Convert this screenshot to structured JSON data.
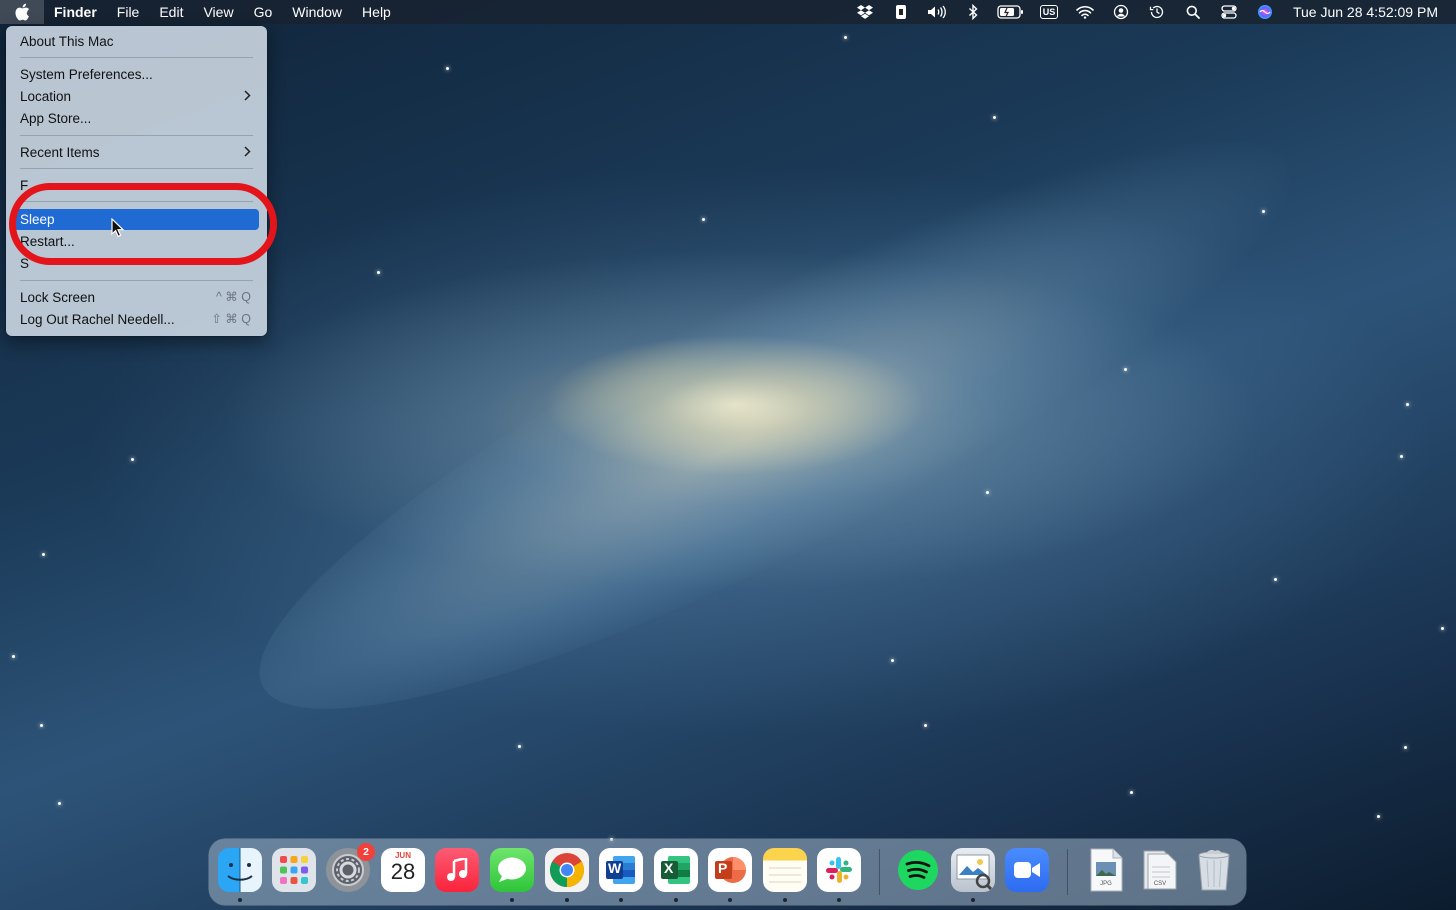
{
  "menubar": {
    "app_name": "Finder",
    "menus": [
      "File",
      "Edit",
      "View",
      "Go",
      "Window",
      "Help"
    ],
    "keyboard_layout": "US",
    "clock": "Tue Jun 28  4:52:09 PM"
  },
  "apple_menu": {
    "items": {
      "about": "About This Mac",
      "system_prefs": "System Preferences...",
      "location": "Location",
      "app_store": "App Store...",
      "recent_items": "Recent Items",
      "force_quit_partial": "F",
      "sleep": "Sleep",
      "restart": "Restart...",
      "shutdown_partial": "S",
      "lock_screen": "Lock Screen",
      "lock_screen_shortcut": "^ ⌘ Q",
      "log_out": "Log Out Rachel Needell...",
      "log_out_shortcut": "⇧ ⌘ Q"
    },
    "highlighted": "Sleep",
    "highlight_color": "#1f6ad3"
  },
  "annotation": {
    "ring_color": "#e4141b"
  },
  "dock": {
    "settings_badge": "2",
    "calendar_month": "JUN",
    "calendar_day": "28",
    "word_letter": "W",
    "excel_letter": "X",
    "powerpoint_letter": "P",
    "jpg_label": "JPG",
    "csv_label": "CSV"
  }
}
